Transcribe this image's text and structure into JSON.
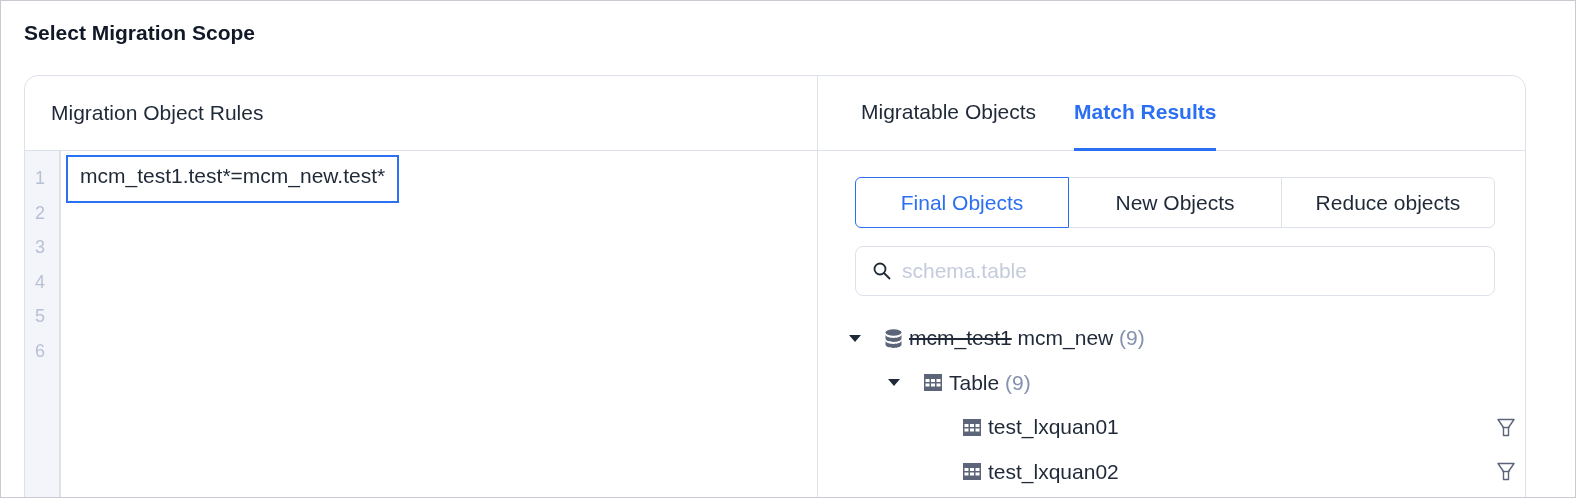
{
  "title": "Select Migration Scope",
  "rules_panel": {
    "title": "Migration Object Rules",
    "lines": [
      {
        "number": "1",
        "text": "mcm_test1.test*=mcm_new.test*",
        "selected": true
      },
      {
        "number": "2"
      },
      {
        "number": "3"
      },
      {
        "number": "4"
      },
      {
        "number": "5"
      },
      {
        "number": "6"
      }
    ]
  },
  "tabs": [
    {
      "label": "Migratable Objects",
      "selected": false
    },
    {
      "label": "Match Results",
      "selected": true
    }
  ],
  "segments": [
    {
      "label": "Final Objects",
      "selected": true
    },
    {
      "label": "New Objects",
      "selected": false
    },
    {
      "label": "Reduce objects",
      "selected": false
    }
  ],
  "search": {
    "placeholder": "schema.table"
  },
  "tree": [
    {
      "kind": "schema",
      "old_name": "mcm_test1",
      "name": "mcm_new",
      "count": "(9)",
      "expanded": true,
      "children": [
        {
          "kind": "group",
          "name": "Table",
          "count": "(9)",
          "expanded": true,
          "children": [
            {
              "kind": "table",
              "name": "test_lxquan01"
            },
            {
              "kind": "table",
              "name": "test_lxquan02"
            }
          ]
        }
      ]
    }
  ]
}
